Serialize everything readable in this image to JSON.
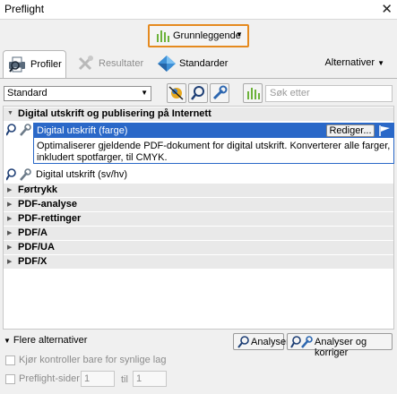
{
  "window": {
    "title": "Preflight"
  },
  "mode_button": {
    "label": "Grunnleggende"
  },
  "tabs": [
    {
      "label": "Profiler",
      "active": true
    },
    {
      "label": "Resultater",
      "disabled": true
    },
    {
      "label": "Standarder"
    }
  ],
  "alternatives_menu": {
    "label": "Alternativer"
  },
  "toolbar": {
    "library_select": {
      "value": "Standard"
    },
    "search": {
      "placeholder": "Søk etter"
    }
  },
  "tree": {
    "group_digital": {
      "label": "Digital utskrift og publisering på Internett"
    },
    "profiles": [
      {
        "label": "Digital utskrift (farge)",
        "selected": true,
        "edit_label": "Rediger...",
        "description": "Optimaliserer gjeldende PDF-dokument for digital utskrift. Konverterer alle farger, inkludert spotfarger, til CMYK."
      },
      {
        "label": "Digital utskrift (sv/hv)"
      }
    ],
    "collapsed_groups": [
      "Førtrykk",
      "PDF-analyse",
      "PDF-rettinger",
      "PDF/A",
      "PDF/UA",
      "PDF/X"
    ]
  },
  "footer": {
    "more_options": "Flere alternativer",
    "analyze_button": "Analyser",
    "analyze_fix_button": "Analyser og korriger",
    "visible_layers_check": "Kjør kontroller bare for synlige lag",
    "pages_check": "Preflight-sider",
    "page_from": "1",
    "page_to_label": "til",
    "page_to": "1"
  },
  "colors": {
    "accent_orange": "#e58a1f",
    "selection_blue": "#2a68c8",
    "chart_green": "#6cb23a"
  }
}
